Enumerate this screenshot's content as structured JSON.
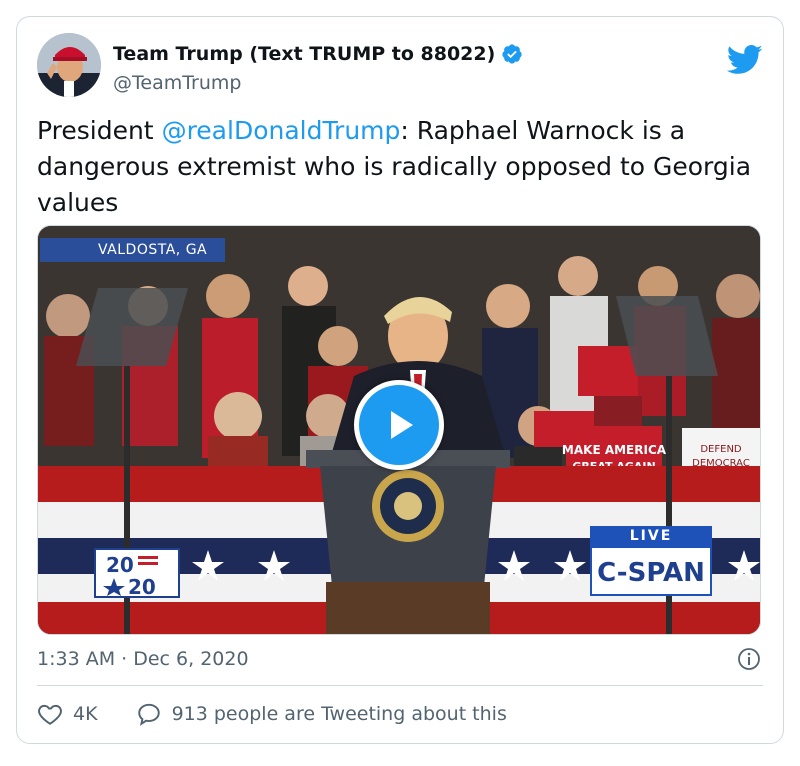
{
  "tweet": {
    "author": {
      "display_name": "Team Trump (Text TRUMP to 88022)",
      "handle": "@TeamTrump",
      "verified": true
    },
    "text": {
      "prefix": "President ",
      "mention": "@realDonaldTrump",
      "suffix": ": Raphael Warnock is a dangerous extremist who is radically opposed to Georgia values"
    },
    "media": {
      "location_tag": "VALDOSTA, GA",
      "live_label": "LIVE",
      "network_label": "C-SPAN",
      "event_logo_top": "20",
      "event_logo_bottom": "20",
      "sign_make_america": "MAKE AMERICA",
      "sign_great_again": "GREAT AGAIN",
      "sign_defend": "DEFEND",
      "sign_democracy": "DEMOCRAC"
    },
    "timestamp": "1:33 AM · Dec 6, 2020",
    "likes": "4K",
    "conversation": "913 people are Tweeting about this"
  },
  "colors": {
    "accent": "#1d9bf0",
    "text": "#0f1419",
    "muted": "#536471",
    "border": "#cfd9de"
  },
  "icons": [
    "verified-icon",
    "twitter-bird-icon",
    "play-icon",
    "info-icon",
    "heart-icon",
    "comment-icon"
  ]
}
